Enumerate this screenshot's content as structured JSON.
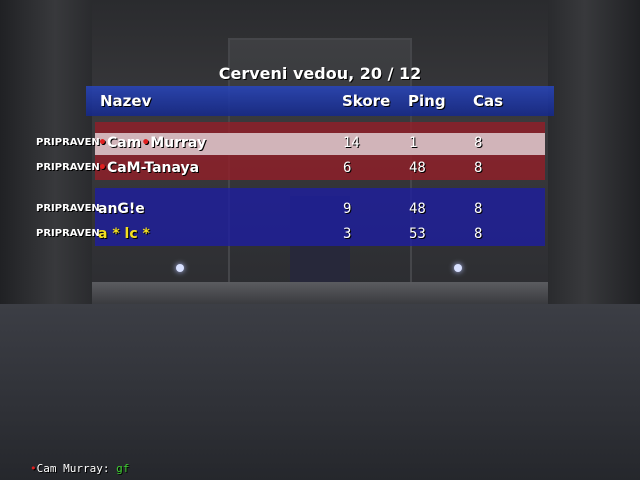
{
  "scoreboard": {
    "title": "Cerveni vedou, 20 / 12",
    "columns": {
      "name": "Nazev",
      "score": "Skore",
      "ping": "Ping",
      "time": "Cas"
    },
    "teams": [
      {
        "team": "red",
        "color": "#961e28",
        "players": [
          {
            "status": "PRIPRAVEN",
            "name_parts": [
              "",
              "Cam",
              "Murray"
            ],
            "score": "14",
            "ping": "1",
            "time": "8",
            "highlighted": true
          },
          {
            "status": "PRIPRAVEN",
            "name_parts": [
              "",
              "CaM-Tanaya"
            ],
            "score": "6",
            "ping": "48",
            "time": "8",
            "highlighted": false
          }
        ]
      },
      {
        "team": "blue",
        "color": "#1e1ea0",
        "players": [
          {
            "status": "PRIPRAVEN",
            "name": "anG!e",
            "score": "9",
            "ping": "48",
            "time": "8"
          },
          {
            "status": "PRIPRAVEN",
            "name": "a  * lc *",
            "score": "3",
            "ping": "53",
            "time": "8"
          }
        ]
      }
    ]
  },
  "chat": {
    "sender": "Cam Murray",
    "separator": ":",
    "message": "gf"
  },
  "colors": {
    "header_band": "#2846be",
    "chat_message": "#3fd030",
    "name_marker": "#e02020"
  }
}
